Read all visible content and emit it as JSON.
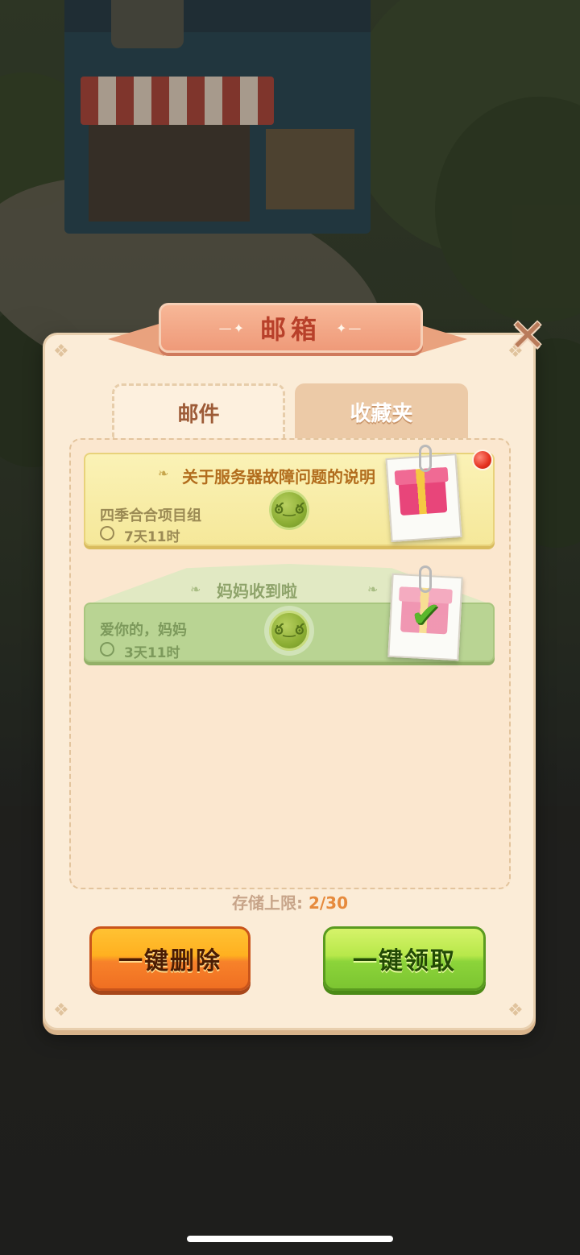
{
  "dialog": {
    "title": "邮箱",
    "close_icon": "close-x-icon"
  },
  "tabs": [
    {
      "label": "邮件",
      "active": true
    },
    {
      "label": "收藏夹",
      "active": false
    }
  ],
  "mails": [
    {
      "subject": "关于服务器故障问题的说明",
      "sender": "四季合合项目组",
      "time_left": "7天11时",
      "status": "unread",
      "has_new_badge": true,
      "attachment_icon": "gift-box-icon"
    },
    {
      "subject": "妈妈收到啦",
      "sender": "爱你的，妈妈",
      "time_left": "3天11时",
      "status": "claimed",
      "attachment_icon": "gift-claimed-check-icon"
    }
  ],
  "storage": {
    "label": "存储上限:",
    "count": "2/30"
  },
  "buttons": {
    "delete_all": "一键删除",
    "claim_all": "一键领取"
  },
  "colors": {
    "panel": "#fbecd7",
    "title_ribbon": "#ef9a79",
    "delete_button": "#f7822a",
    "claim_button": "#8cd43a",
    "storage_count": "#e68a3c"
  }
}
